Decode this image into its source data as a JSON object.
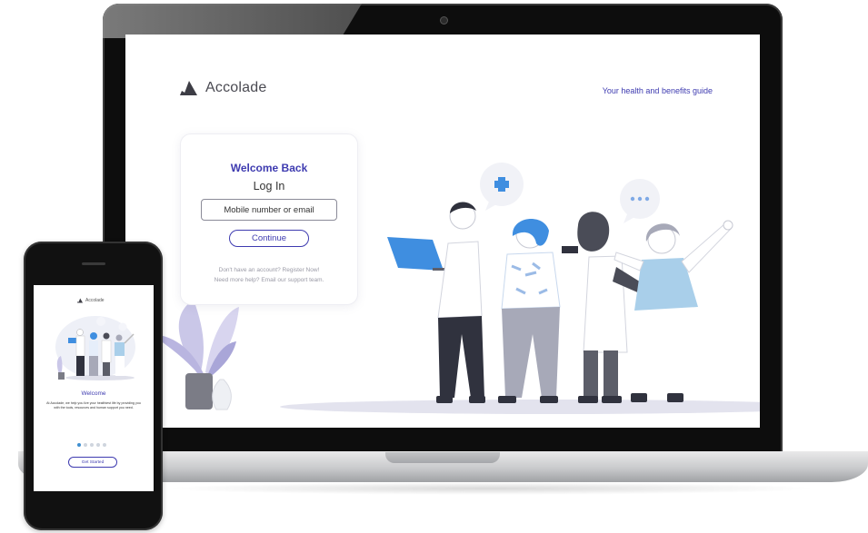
{
  "brand": {
    "name": "Accolade",
    "tagline": "Your health and benefits guide",
    "accent": "#3e3bb0"
  },
  "login": {
    "welcome": "Welcome Back",
    "title": "Log In",
    "input_placeholder": "Mobile number or email",
    "continue_label": "Continue",
    "register_text": "Don't have an account? Register Now!",
    "help_text": "Need more help? Email our support team."
  },
  "mobile": {
    "brand": "Accolade",
    "welcome": "Welcome",
    "description": "At Accolade, we help you live your healthiest life by providing you with the tools, resources and human support you need.",
    "carousel_pages": 5,
    "carousel_active": 1,
    "button_label": "Get Started"
  },
  "icons": [
    "accolade-logo-icon",
    "plus-bubble-icon",
    "ellipsis-bubble-icon",
    "laptop-icon",
    "plant-icon"
  ]
}
